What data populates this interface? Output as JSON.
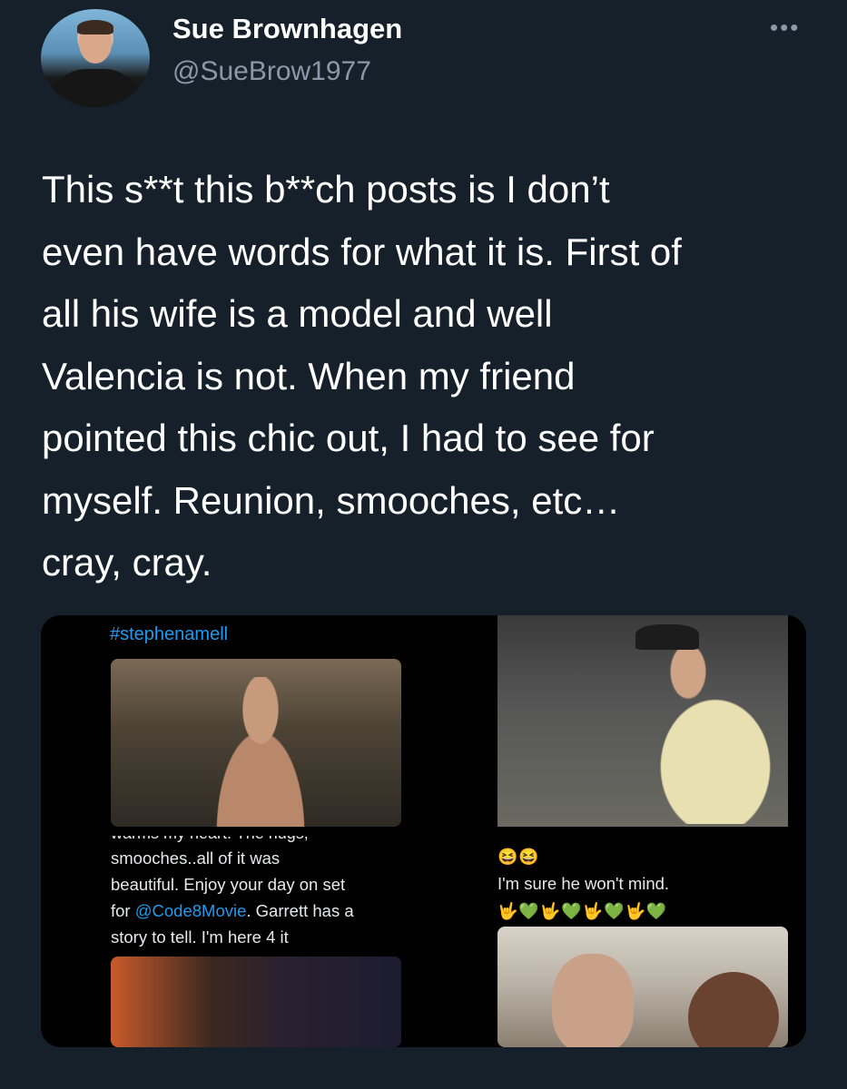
{
  "author": {
    "display_name": "Sue Brownhagen",
    "handle": "@SueBrow1977"
  },
  "icons": {
    "more": "more-horizontal-icon"
  },
  "more_glyph": "•••",
  "tweet": {
    "text": "This s**t this b**ch posts is I don’t\neven have words for what it is. First of\nall his wife is a model and well\nValencia is not. When my friend\npointed this chic out, I had to see for\nmyself. Reunion, smooches, etc…\ncray, cray."
  },
  "media": {
    "cell1": {
      "hashtag": "#stephenamell"
    },
    "cell3": {
      "cutoff_line": "warms my heart. The hugs,",
      "line1": "smooches..all of it was",
      "line2": "beautiful. Enjoy your day on set",
      "line3_prefix": "for ",
      "line3_mention": "@Code8Movie",
      "line3_suffix": ". Garrett has a",
      "line4": "story to tell. I'm here 4 it"
    },
    "cell4": {
      "emoji_top": "😆😆",
      "line1": "I'm sure he won't mind.",
      "emoji_bottom": "🤟💚🤟💚🤟💚🤟💚"
    }
  }
}
